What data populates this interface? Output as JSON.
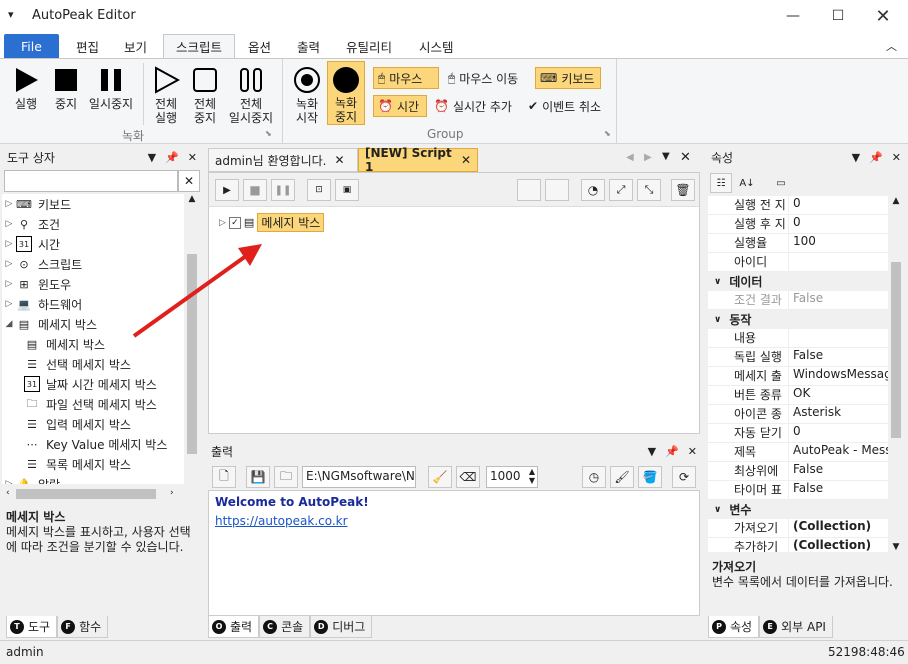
{
  "window": {
    "title": "AutoPeak Editor"
  },
  "ribbon_tabs": [
    "File",
    "편집",
    "보기",
    "스크립트",
    "옵션",
    "출력",
    "유틸리티",
    "시스템"
  ],
  "ribbon": {
    "run": "실행",
    "stop": "중지",
    "pause": "일시중지",
    "run_all": [
      "전체",
      "실행"
    ],
    "stop_all": [
      "전체",
      "중지"
    ],
    "pause_all": [
      "전체",
      "일시중지"
    ],
    "group_record": "녹화",
    "rec_start": [
      "녹화",
      "시작"
    ],
    "rec_stop": [
      "녹화",
      "중지"
    ],
    "mouse": "마우스",
    "mouse_move": "마우스 이동",
    "keyboard": "키보드",
    "time": "시간",
    "realtime_add": "실시간 추가",
    "event_cancel": "이벤트 취소",
    "group_group": "Group"
  },
  "toolbox": {
    "title": "도구 상자",
    "items": [
      {
        "label": "키보드",
        "icon": "keyboard-icon"
      },
      {
        "label": "조건",
        "icon": "condition-icon"
      },
      {
        "label": "시간",
        "icon": "calendar-icon"
      },
      {
        "label": "스크립트",
        "icon": "script-icon"
      },
      {
        "label": "윈도우",
        "icon": "windows-icon"
      },
      {
        "label": "하드웨어",
        "icon": "computer-icon"
      },
      {
        "label": "메세지 박스",
        "icon": "message-icon"
      }
    ],
    "children": [
      {
        "label": "메세지 박스",
        "icon": "message-icon"
      },
      {
        "label": "선택 메세지 박스",
        "icon": "list-icon"
      },
      {
        "label": "날짜 시간 메세지 박스",
        "icon": "calendar-icon"
      },
      {
        "label": "파일 선택 메세지 박스",
        "icon": "folder-icon"
      },
      {
        "label": "입력 메세지 박스",
        "icon": "list-icon"
      },
      {
        "label": "Key Value 메세지 박스",
        "icon": "dots-icon"
      },
      {
        "label": "목록 메세지 박스",
        "icon": "list-icon"
      }
    ],
    "last_item": "알람",
    "desc_title": "메세지 박스",
    "desc_text": "메세지 박스를 표시하고, 사용자 선택에 따라 조건을 분기할 수 있습니다.",
    "tab_tools": "도구",
    "tab_functions": "함수"
  },
  "editor": {
    "tab_welcome": "admin님 환영합니다.",
    "tab_script": "[NEW] Script 1",
    "node_label": "메세지 박스"
  },
  "output": {
    "title": "출력",
    "path": "E:\\NGMsoftware\\NG",
    "delay": "1000",
    "welcome": "Welcome to AutoPeak!",
    "link": "https://autopeak.co.kr",
    "tab_output": "출력",
    "tab_console": "콘솔",
    "tab_debug": "디버그"
  },
  "properties": {
    "title": "속성",
    "rows_top": [
      {
        "k": "실행 전 지",
        "v": "0"
      },
      {
        "k": "실행 후 지",
        "v": "0"
      },
      {
        "k": "실행율",
        "v": "100"
      },
      {
        "k": "아이디",
        "v": ""
      }
    ],
    "cat_data": "데이터",
    "rows_data": [
      {
        "k": "조건 결과",
        "v": "False"
      }
    ],
    "cat_action": "동작",
    "rows_action": [
      {
        "k": "내용",
        "v": ""
      },
      {
        "k": "독립 실행",
        "v": "False"
      },
      {
        "k": "메세지 출",
        "v": "WindowsMessage"
      },
      {
        "k": "버튼 종류",
        "v": "OK"
      },
      {
        "k": "아이콘 종",
        "v": "Asterisk"
      },
      {
        "k": "자동 닫기",
        "v": "0"
      },
      {
        "k": "제목",
        "v": "AutoPeak - Messa"
      },
      {
        "k": "최상위에",
        "v": "False"
      },
      {
        "k": "타이머 표",
        "v": "False"
      }
    ],
    "cat_var": "변수",
    "rows_var": [
      {
        "k": "가져오기",
        "v": "(Collection)"
      },
      {
        "k": "추가하기",
        "v": "(Collection)"
      }
    ],
    "desc_title": "가져오기",
    "desc_text": "변수 목록에서 데이터를 가져옵니다.",
    "tab_props": "속성",
    "tab_api": "외부 API"
  },
  "status": {
    "user": "admin",
    "clock": "52198:48:46"
  },
  "colors": {
    "accent": "#2b6fd1",
    "highlight": "#fbd67a",
    "arrow": "#e0201a"
  }
}
